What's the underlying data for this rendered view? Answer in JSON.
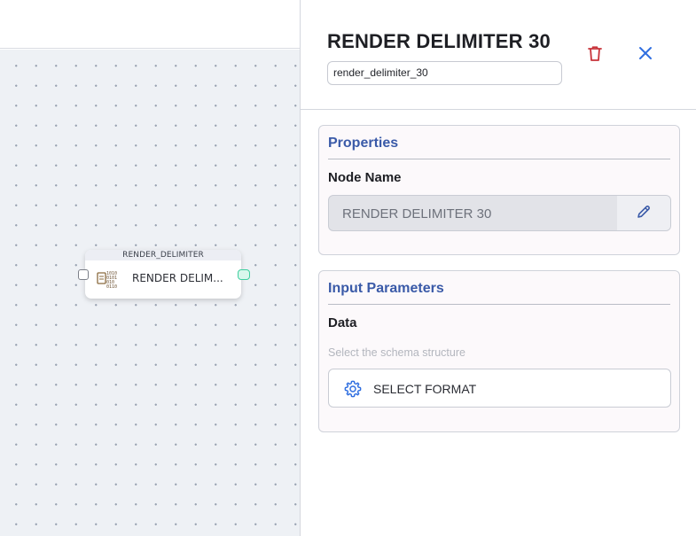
{
  "canvas": {
    "node": {
      "type_label": "RENDER_DELIMITER",
      "label": "RENDER DELIM...",
      "icon": "binary-data-icon"
    }
  },
  "panel": {
    "title": "RENDER DELIMITER 30",
    "id_value": "render_delimiter_30",
    "delete_icon": "trash-icon",
    "close_icon": "close-icon",
    "properties": {
      "title": "Properties",
      "node_name_label": "Node Name",
      "node_name_value": "RENDER DELIMITER 30",
      "edit_icon": "pencil-icon"
    },
    "input_parameters": {
      "title": "Input Parameters",
      "data_label": "Data",
      "hint": "Select the schema structure",
      "select_button_label": "SELECT FORMAT",
      "select_icon": "gear-icon"
    }
  },
  "colors": {
    "accent": "#3a5aa8",
    "delete": "#c8333a",
    "close": "#2f6ee0",
    "port_output": "#3fcf9f"
  }
}
